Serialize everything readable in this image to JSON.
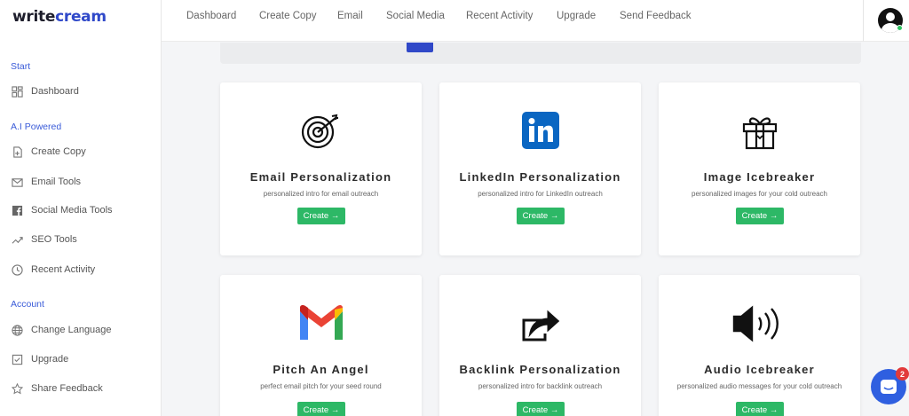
{
  "brand": {
    "part1": "write",
    "part2": "cream"
  },
  "nav": [
    "Dashboard",
    "Create Copy",
    "Email",
    "Social Media",
    "Recent Activity",
    "Upgrade",
    "Send Feedback"
  ],
  "sidebar": {
    "sections": [
      "Start",
      "A.I Powered",
      "Account"
    ],
    "items": [
      {
        "label": "Dashboard",
        "icon": "dashboard-icon"
      },
      {
        "label": "Create Copy",
        "icon": "file-plus-icon"
      },
      {
        "label": "Email Tools",
        "icon": "mail-icon"
      },
      {
        "label": "Social Media Tools",
        "icon": "facebook-icon"
      },
      {
        "label": "SEO Tools",
        "icon": "trend-icon"
      },
      {
        "label": "Recent Activity",
        "icon": "clock-icon"
      },
      {
        "label": "Change Language",
        "icon": "globe-icon"
      },
      {
        "label": "Upgrade",
        "icon": "checkbox-icon"
      },
      {
        "label": "Share Feedback",
        "icon": "star-icon"
      }
    ]
  },
  "cards": [
    {
      "title": "Email Personalization",
      "subtitle": "personalized intro for email outreach",
      "button": "Create →",
      "icon": "target-icon"
    },
    {
      "title": "LinkedIn Personalization",
      "subtitle": "personalized intro for LinkedIn outreach",
      "button": "Create →",
      "icon": "linkedin-icon"
    },
    {
      "title": "Image Icebreaker",
      "subtitle": "personalized images for your cold outreach",
      "button": "Create →",
      "icon": "gift-icon"
    },
    {
      "title": "Pitch An Angel",
      "subtitle": "perfect email pitch for your seed round",
      "button": "Create →",
      "icon": "gmail-icon"
    },
    {
      "title": "Backlink Personalization",
      "subtitle": "personalized intro for backlink outreach",
      "button": "Create →",
      "icon": "share-icon"
    },
    {
      "title": "Audio Icebreaker",
      "subtitle": "personalized audio messages for your cold outreach",
      "button": "Create →",
      "icon": "speaker-icon"
    }
  ],
  "chat": {
    "badge": "2"
  },
  "colors": {
    "accent": "#3049c9",
    "create_button": "#2db866",
    "badge": "#e23a3a"
  }
}
